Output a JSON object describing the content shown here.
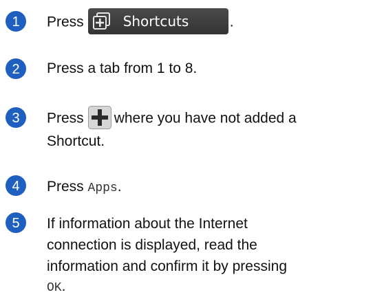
{
  "steps": [
    {
      "number": "1",
      "press": "Press",
      "button_label": "Shortcuts",
      "end": "."
    },
    {
      "number": "2",
      "text": "Press a tab from 1 to 8."
    },
    {
      "number": "3",
      "press": "Press",
      "after": "where you have not added a",
      "line2": "Shortcut."
    },
    {
      "number": "4",
      "press": "Press",
      "code": "Apps",
      "end": "."
    },
    {
      "number": "5",
      "line1": "If information about the Internet",
      "line2": "connection is displayed, read the",
      "line3": "information and confirm it by pressing",
      "code": "OK",
      "end": "."
    }
  ],
  "colors": {
    "badge": "#1f5fbf",
    "button_bg": "#3a3a3a",
    "plus_green": "#2f8f2f"
  }
}
